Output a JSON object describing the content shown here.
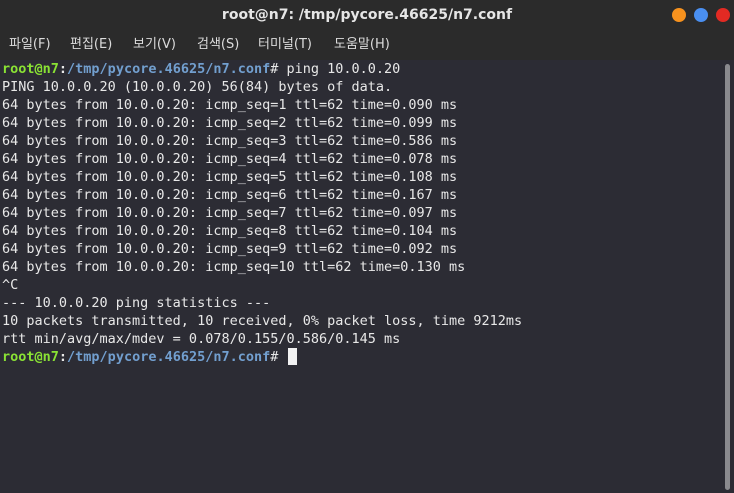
{
  "window": {
    "title": "root@n7: /tmp/pycore.46625/n7.conf"
  },
  "menu": {
    "file": "파일(F)",
    "edit": "편집(E)",
    "view": "보기(V)",
    "search": "검색(S)",
    "terminal": "터미널(T)",
    "help": "도움말(H)"
  },
  "prompt": {
    "user": "root@n7",
    "colon": ":",
    "path": "/tmp/pycore.46625/n7.conf",
    "symbol": "# "
  },
  "terminal": {
    "command": "ping 10.0.0.20",
    "lines": [
      "PING 10.0.0.20 (10.0.0.20) 56(84) bytes of data.",
      "64 bytes from 10.0.0.20: icmp_seq=1 ttl=62 time=0.090 ms",
      "64 bytes from 10.0.0.20: icmp_seq=2 ttl=62 time=0.099 ms",
      "64 bytes from 10.0.0.20: icmp_seq=3 ttl=62 time=0.586 ms",
      "64 bytes from 10.0.0.20: icmp_seq=4 ttl=62 time=0.078 ms",
      "64 bytes from 10.0.0.20: icmp_seq=5 ttl=62 time=0.108 ms",
      "64 bytes from 10.0.0.20: icmp_seq=6 ttl=62 time=0.167 ms",
      "64 bytes from 10.0.0.20: icmp_seq=7 ttl=62 time=0.097 ms",
      "64 bytes from 10.0.0.20: icmp_seq=8 ttl=62 time=0.104 ms",
      "64 bytes from 10.0.0.20: icmp_seq=9 ttl=62 time=0.092 ms",
      "64 bytes from 10.0.0.20: icmp_seq=10 ttl=62 time=0.130 ms",
      "^C",
      "--- 10.0.0.20 ping statistics ---",
      "10 packets transmitted, 10 received, 0% packet loss, time 9212ms",
      "rtt min/avg/max/mdev = 0.078/0.155/0.586/0.145 ms"
    ]
  },
  "colors": {
    "prompt_user": "#8ae234",
    "prompt_path": "#729fcf",
    "terminal_bg": "#2c2c34",
    "close": "#e22a23",
    "maximize": "#4a8ff0",
    "minimize": "#f7921e"
  }
}
